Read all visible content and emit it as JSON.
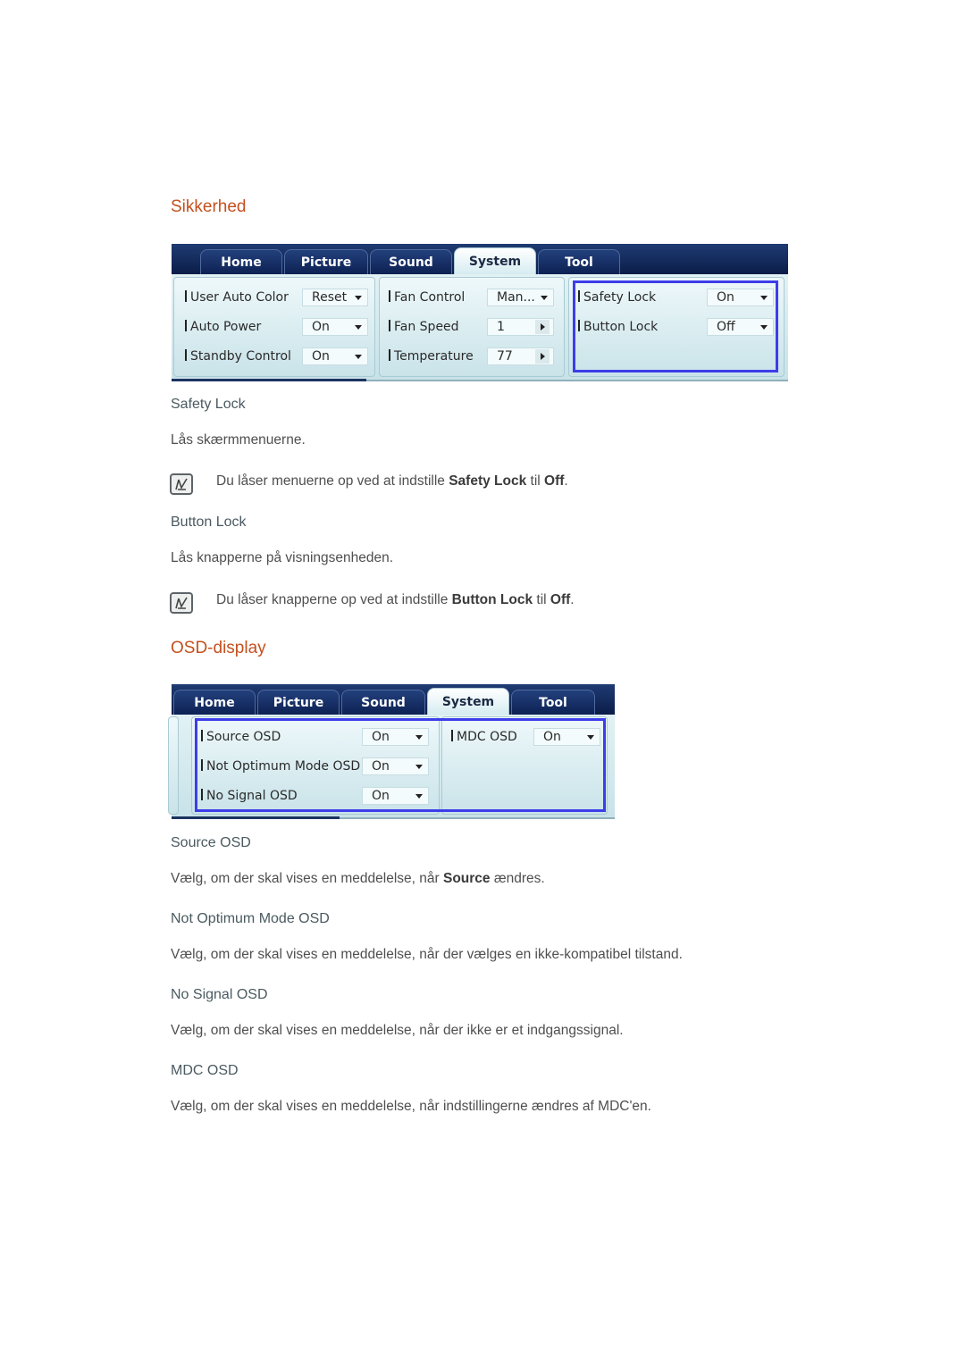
{
  "sections": {
    "security_title": "Sikkerhed",
    "osd_title": "OSD-display"
  },
  "panel1": {
    "tabs": [
      "Home",
      "Picture",
      "Sound",
      "System",
      "Tool"
    ],
    "active_tab": "System",
    "group1": [
      {
        "label": "User Auto Color",
        "value": "Reset",
        "control": "dropdown"
      },
      {
        "label": "Auto Power",
        "value": "On",
        "control": "dropdown"
      },
      {
        "label": "Standby Control",
        "value": "On",
        "control": "dropdown"
      }
    ],
    "group2": [
      {
        "label": "Fan Control",
        "value": "Man...",
        "control": "dropdown"
      },
      {
        "label": "Fan Speed",
        "value": "1",
        "control": "stepper"
      },
      {
        "label": "Temperature",
        "value": "77",
        "control": "stepper"
      }
    ],
    "group3": [
      {
        "label": "Safety Lock",
        "value": "On",
        "control": "dropdown"
      },
      {
        "label": "Button Lock",
        "value": "Off",
        "control": "dropdown"
      }
    ]
  },
  "safety": {
    "safety_lock_title": "Safety Lock",
    "safety_lock_desc": "Lås skærmmenuerne.",
    "safety_note_pre": "Du låser menuerne op ved at indstille ",
    "safety_note_b1": "Safety Lock",
    "safety_note_mid": " til ",
    "safety_note_b2": "Off",
    "safety_note_post": ".",
    "button_lock_title": "Button Lock",
    "button_lock_desc": "Lås knapperne på visningsenheden.",
    "button_note_pre": "Du låser knapperne op ved at indstille ",
    "button_note_b1": "Button Lock",
    "button_note_mid": " til ",
    "button_note_b2": "Off",
    "button_note_post": "."
  },
  "panel2": {
    "tabs": [
      "Home",
      "Picture",
      "Sound",
      "System",
      "Tool"
    ],
    "active_tab": "System",
    "group1": [
      {
        "label": "Source OSD",
        "value": "On"
      },
      {
        "label": "Not Optimum Mode OSD",
        "value": "On"
      },
      {
        "label": "No Signal OSD",
        "value": "On"
      }
    ],
    "group2": [
      {
        "label": "MDC OSD",
        "value": "On"
      }
    ]
  },
  "osd": {
    "source_title": "Source OSD",
    "source_desc_pre": "Vælg, om der skal vises en meddelelse, når ",
    "source_desc_b": "Source",
    "source_desc_post": " ændres.",
    "notopt_title": "Not Optimum Mode OSD",
    "notopt_desc": "Vælg, om der skal vises en meddelelse, når der vælges en ikke-kompatibel tilstand.",
    "nosignal_title": "No Signal OSD",
    "nosignal_desc": "Vælg, om der skal vises en meddelelse, når der ikke er et indgangssignal.",
    "mdc_title": "MDC OSD",
    "mdc_desc": "Vælg, om der skal vises en meddelelse, når indstillingerne ændres af MDC'en."
  }
}
